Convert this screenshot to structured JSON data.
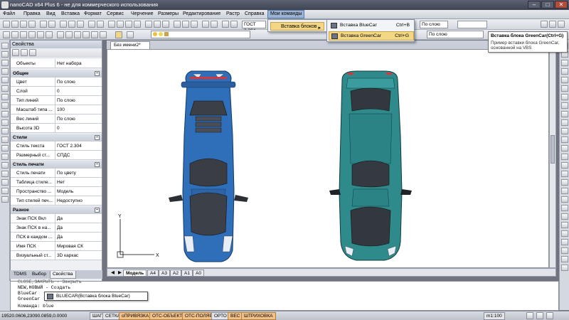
{
  "window": {
    "title": "nanoCAD x64 Plus 6 - не для коммерческого использования",
    "minimize": "–",
    "maximize": "□",
    "close": "✕"
  },
  "menubar": [
    "Файл",
    "Правка",
    "Вид",
    "Вставка",
    "Формат",
    "Сервис",
    "Черчение",
    "Размеры",
    "Редактирование",
    "Растр",
    "Справка",
    "Мои команды"
  ],
  "toolbar": {
    "text_style": "ГОСТ 2.304",
    "layer_value": "По слою",
    "layer_value2": "По слою"
  },
  "menu": {
    "parent_label": "Вставка блоков",
    "items": [
      {
        "label": "Вставка BlueCar",
        "shortcut": "Ctrl+B"
      },
      {
        "label": "Вставка GreenCar",
        "shortcut": "Ctrl+G"
      }
    ]
  },
  "tooltip": {
    "title": "Вставка блока GreenCar(Ctrl+G)",
    "body": "Пример вставки блока GreenCar, основанной на VBS"
  },
  "properties": {
    "header": "Свойства",
    "objects_label": "Объекты",
    "objects_value": "Нет набора",
    "sections": [
      {
        "title": "Общие",
        "rows": [
          {
            "label": "Цвет",
            "value": "По слою"
          },
          {
            "label": "Слой",
            "value": "0"
          },
          {
            "label": "Тип линий",
            "value": "По слою"
          },
          {
            "label": "Масштаб типа ...",
            "value": "100"
          },
          {
            "label": "Вес линий",
            "value": "По слою"
          },
          {
            "label": "Высота 3D",
            "value": "0"
          }
        ]
      },
      {
        "title": "Стили",
        "rows": [
          {
            "label": "Стиль текста",
            "value": "ГОСТ 2.304"
          },
          {
            "label": "Размерный ст...",
            "value": "СПДС"
          }
        ]
      },
      {
        "title": "Стиль печати",
        "rows": [
          {
            "label": "Стиль печати",
            "value": "По цвету"
          },
          {
            "label": "Таблица стиле...",
            "value": "Нет"
          },
          {
            "label": "Пространство ...",
            "value": "Модель"
          },
          {
            "label": "Тип стилей печ...",
            "value": "Недоступно"
          }
        ]
      },
      {
        "title": "Разное",
        "rows": [
          {
            "label": "Знак ПСК Вкл",
            "value": "Да"
          },
          {
            "label": "Знак ПСК в на...",
            "value": "Да"
          },
          {
            "label": "ПСК в каждом ...",
            "value": "Да"
          },
          {
            "label": "Имя ПСК",
            "value": "Мировая СК"
          },
          {
            "label": "Визуальный ст...",
            "value": "3D каркас"
          }
        ]
      }
    ]
  },
  "panel_tabs": [
    "TDMS",
    "Выбор",
    "Свойства"
  ],
  "document_tab": "Без имени2*",
  "layout_tabs": [
    "Модель",
    "A4",
    "A3",
    "A2",
    "A1",
    "A0"
  ],
  "ucs": {
    "x": "X",
    "y": "Y"
  },
  "command_lines": [
    "NEW,НОВЫЙ - Создать",
    "BlueCar",
    "GreenCar",
    "Команда: blue"
  ],
  "command_partial": "CLOSE,ЗАКРЫТЬ - Закрыть",
  "autocomplete": "BLUECAR(Вставка блока BlueCar)",
  "status": {
    "coords": "19520.0606,23090.0859,0.0000",
    "buttons": [
      "ШАГ",
      "СЕТКА",
      "оПРИВЯЗКА",
      "ОТС-ОБЪЕКТ",
      "ОТС-ПОЛЯР",
      "ОРТО",
      "ВЕС",
      "ШТРИХОВКА"
    ],
    "scale": "m1:100"
  },
  "colors": {
    "blue_car": "#2f6eb8",
    "green_car": "#2f8a8c",
    "menu_highlight": "#f4d784"
  }
}
